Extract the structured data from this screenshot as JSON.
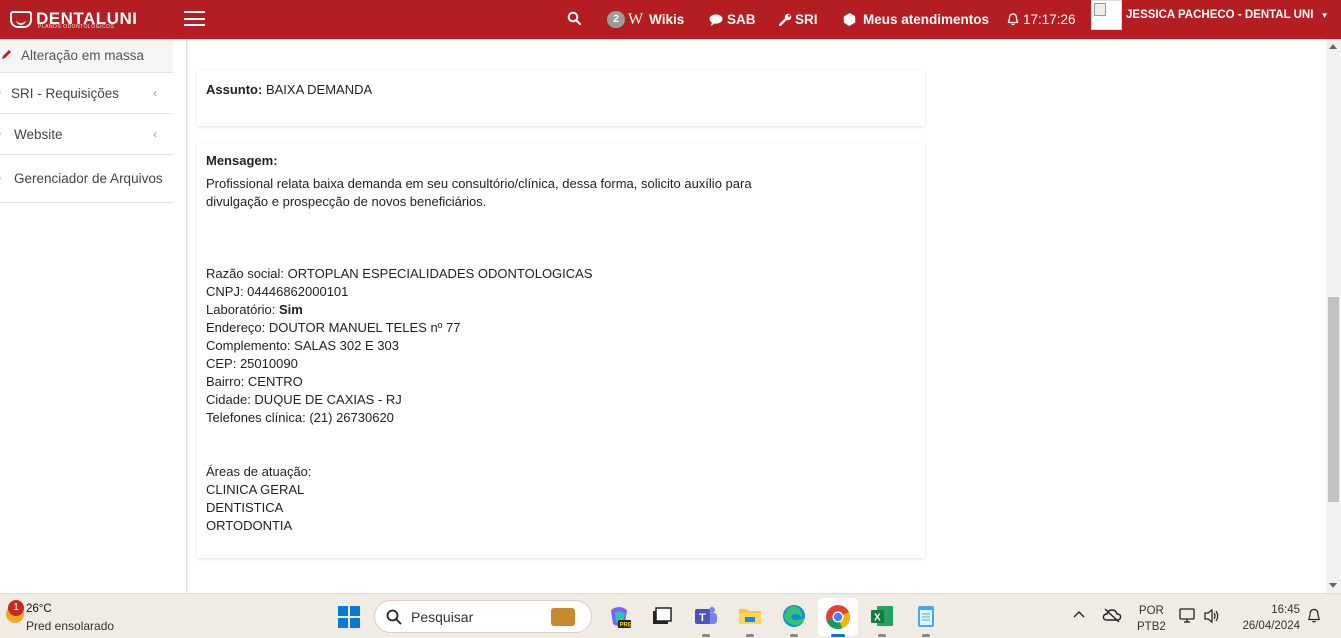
{
  "brand": {
    "logo_text": "DENTALUNI",
    "logo_sub": "PLANOS ODONTOLÓGICOS",
    "color": "#b41d21"
  },
  "nav": {
    "wikis_count": "2",
    "wikis_w": "W",
    "wikis_label": "Wikis",
    "sab_label": "SAB",
    "sri_label": "SRI",
    "atendimentos_label": "Meus atendimentos",
    "time": "17:17:26",
    "user_label": "JESSICA PACHECO - DENTAL UNI"
  },
  "sidebar": {
    "items": [
      {
        "label": "Alteração em massa",
        "icon": "pencil-icon"
      },
      {
        "label": "SRI - Requisições",
        "icon": "dot-icon"
      },
      {
        "label": "Website",
        "icon": "dot-icon"
      },
      {
        "label": "Gerenciador de Arquivos",
        "icon": "dot-icon"
      }
    ]
  },
  "subject": {
    "label": "Assunto:",
    "value": "BAIXA DEMANDA"
  },
  "message": {
    "label": "Mensagem:",
    "paragraph": [
      "Profissional relata baixa demanda em seu consultório/clínica, dessa forma, solicito auxílio para",
      "divulgação e prospecção de novos beneficiários."
    ],
    "razao_social": "Razão social: ORTOPLAN ESPECIALIDADES ODONTOLOGICAS",
    "cnpj": "CNPJ: 04446862000101",
    "laboratorio_label": "Laboratório: ",
    "laboratorio_value": "Sim",
    "endereco": "Endereço: DOUTOR MANUEL TELES nº 77",
    "complemento": "Complemento: SALAS 302 E 303",
    "cep": "CEP: 25010090",
    "bairro": "Bairro: CENTRO",
    "cidade": "Cidade: DUQUE DE CAXIAS - RJ",
    "telefones": "Telefones clínica: (21) 26730620",
    "areas_label": "Áreas de atuação:",
    "areas": [
      "CLINICA GERAL",
      "DENTISTICA",
      "ORTODONTIA"
    ]
  },
  "taskbar": {
    "notifications": "1",
    "temperature": "26°C",
    "condition": "Pred ensolarado",
    "search_placeholder": "Pesquisar",
    "lang_1": "POR",
    "lang_2": "PTB2",
    "time": "16:45",
    "date": "26/04/2024",
    "accent": "#0a78d4"
  }
}
